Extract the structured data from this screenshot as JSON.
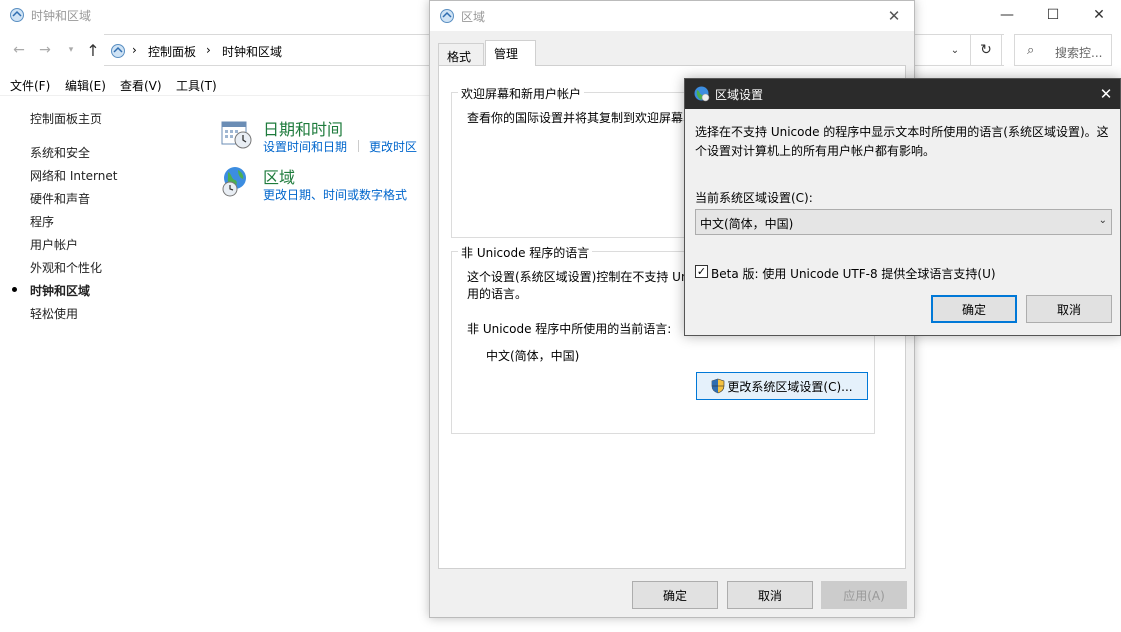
{
  "control_panel": {
    "title": "时钟和区域",
    "window_buttons": {
      "minimize": "—",
      "maximize": "☐",
      "close": "✕"
    },
    "nav": {
      "back": "←",
      "forward": "→",
      "dropdown": "▾",
      "up": "↑",
      "refresh": "↻",
      "addr_dropdown": "⌄"
    },
    "breadcrumb": [
      "›",
      "控制面板",
      "›",
      "时钟和区域"
    ],
    "search_placeholder": "搜索控...",
    "search_icon": "⌕",
    "menu": [
      "文件(F)",
      "编辑(E)",
      "查看(V)",
      "工具(T)"
    ],
    "sidebar": [
      "控制面板主页",
      "系统和安全",
      "网络和 Internet",
      "硬件和声音",
      "程序",
      "用户帐户",
      "外观和个性化",
      "时钟和区域",
      "轻松使用"
    ],
    "categories": [
      {
        "title": "日期和时间",
        "links": [
          "设置时间和日期",
          "更改时区"
        ]
      },
      {
        "title": "区域",
        "links": [
          "更改日期、时间或数字格式"
        ]
      }
    ]
  },
  "region_dialog": {
    "title": "区域",
    "close": "✕",
    "tabs": [
      "格式",
      "管理"
    ],
    "welcome_group": {
      "title": "欢迎屏幕和新用户帐户",
      "text": "查看你的国际设置并将其复制到欢迎屏幕、"
    },
    "unicode_group": {
      "title": "非 Unicode 程序的语言",
      "text_line1": "这个设置(系统区域设置)控制在不支持 Uni",
      "text_line2": "用的语言。",
      "current_label": "非 Unicode 程序中所使用的当前语言:",
      "current_value": "中文(简体，中国)",
      "change_button": "更改系统区域设置(C)..."
    },
    "buttons": {
      "ok": "确定",
      "cancel": "取消",
      "apply": "应用(A)"
    }
  },
  "region_settings": {
    "title": "区域设置",
    "close": "✕",
    "description": "选择在不支持 Unicode 的程序中显示文本时所使用的语言(系统区域设置)。这个设置对计算机上的所有用户帐户都有影响。",
    "current_label": "当前系统区域设置(C):",
    "current_value": "中文(简体，中国)",
    "dropdown_arrow": "⌄",
    "beta_checkbox_checked": true,
    "beta_label": "Beta 版: 使用 Unicode UTF-8 提供全球语言支持(U)",
    "check_mark": "✓",
    "buttons": {
      "ok": "确定",
      "cancel": "取消"
    }
  }
}
